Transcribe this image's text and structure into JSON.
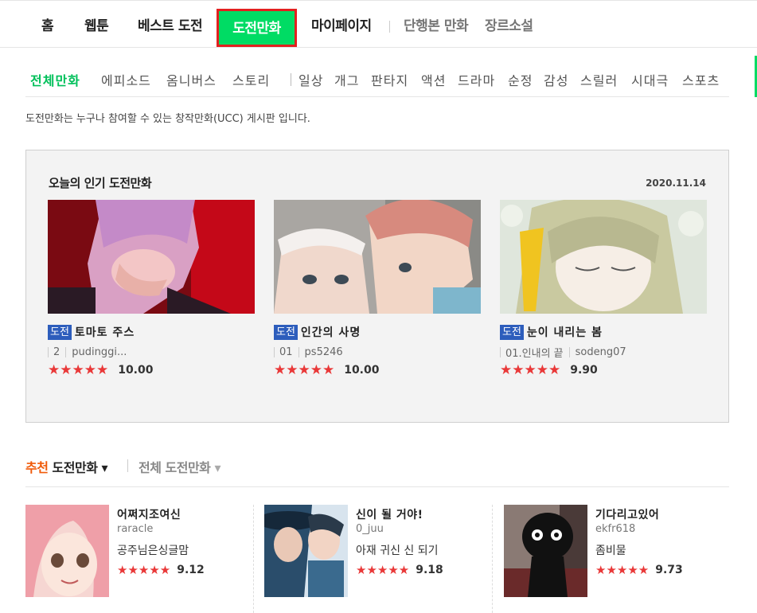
{
  "topnav": {
    "items": [
      "홈",
      "웹툰",
      "베스트 도전",
      "도전만화",
      "마이페이지",
      "단행본 만화",
      "장르소설"
    ]
  },
  "subnav": {
    "items": [
      "전체만화",
      "에피소드",
      "옴니버스",
      "스토리",
      "일상",
      "개그",
      "판타지",
      "액션",
      "드라마",
      "순정",
      "감성",
      "스릴러",
      "시대극",
      "스포츠"
    ]
  },
  "description": "도전만화는 누구나 참여할 수 있는 창작만화(UCC) 게시판 입니다.",
  "popular": {
    "title": "오늘의 인기 도전만화",
    "date": "2020.11.14",
    "cards": [
      {
        "badge": "도전",
        "title": "토마토 주스",
        "episode": "2",
        "author": "pudinggi...",
        "stars": "★★★★★",
        "score": "10.00"
      },
      {
        "badge": "도전",
        "title": "인간의 사명",
        "episode": "01",
        "author": "ps5246",
        "stars": "★★★★★",
        "score": "10.00"
      },
      {
        "badge": "도전",
        "title": "눈이 내리는 봄",
        "episode": "01.인내의 끝",
        "author": "sodeng07",
        "stars": "★★★★★",
        "score": "9.90"
      }
    ]
  },
  "recommend": {
    "tab_active_prefix": "추천",
    "tab_active_label": "도전만화",
    "tab_active_arrow": "▾",
    "tab_other_label": "전체 도전만화",
    "tab_other_arrow": "▾",
    "items": [
      {
        "title": "어쩌지조여신",
        "author": "raracle",
        "desc": "공주님은싱글맘",
        "stars": "★★★★★",
        "score": "9.12"
      },
      {
        "title": "신이 될 거야!",
        "author": "0_juu",
        "desc": "아재 귀신 신 되기",
        "stars": "★★★★★",
        "score": "9.18"
      },
      {
        "title": "기다리고있어",
        "author": "ekfr618",
        "desc": "좀비물",
        "stars": "★★★★★",
        "score": "9.73"
      }
    ]
  },
  "colors": {
    "accent": "#00dc64",
    "highlight_border": "#e32020",
    "star": "#e93838",
    "badge": "#2d5dbc",
    "orange": "#f05a0a"
  }
}
